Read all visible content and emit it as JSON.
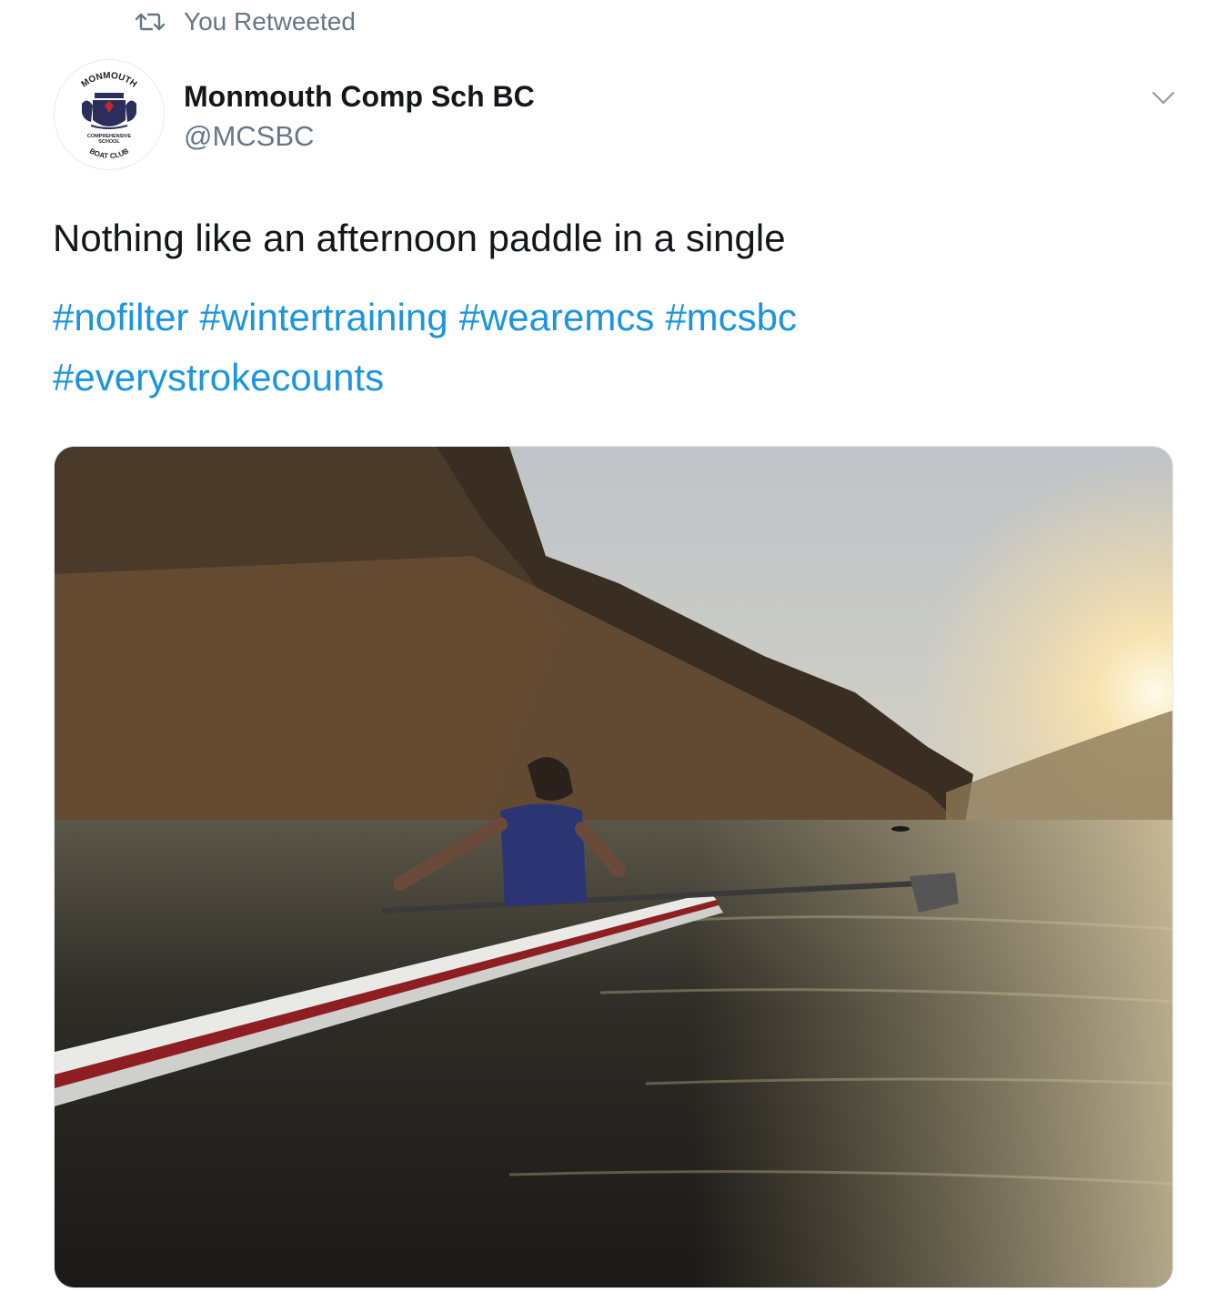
{
  "retweet": {
    "label": "You Retweeted",
    "icon": "retweet-icon"
  },
  "author": {
    "name": "Monmouth Comp Sch BC",
    "handle": "@MCSBC",
    "avatar": {
      "icon": "club-crest-logo",
      "logo_text_top": "MONMOUTH",
      "logo_text_mid1": "COMPREHENSIVE",
      "logo_text_mid2": "SCHOOL",
      "logo_text_bottom": "BOAT CLUB"
    }
  },
  "tweet": {
    "text": "Nothing like an afternoon paddle in a single",
    "hashtags": [
      "#nofilter",
      "#wintertraining",
      "#wearemcs",
      "#mcsbc",
      "#everystrokecounts"
    ]
  },
  "menu": {
    "icon": "chevron-down-icon"
  },
  "media": {
    "icon": "photo-rower-single-scull-river-sunset"
  },
  "colors": {
    "link": "#1b95e0",
    "secondary": "#657786",
    "text": "#14171a"
  }
}
